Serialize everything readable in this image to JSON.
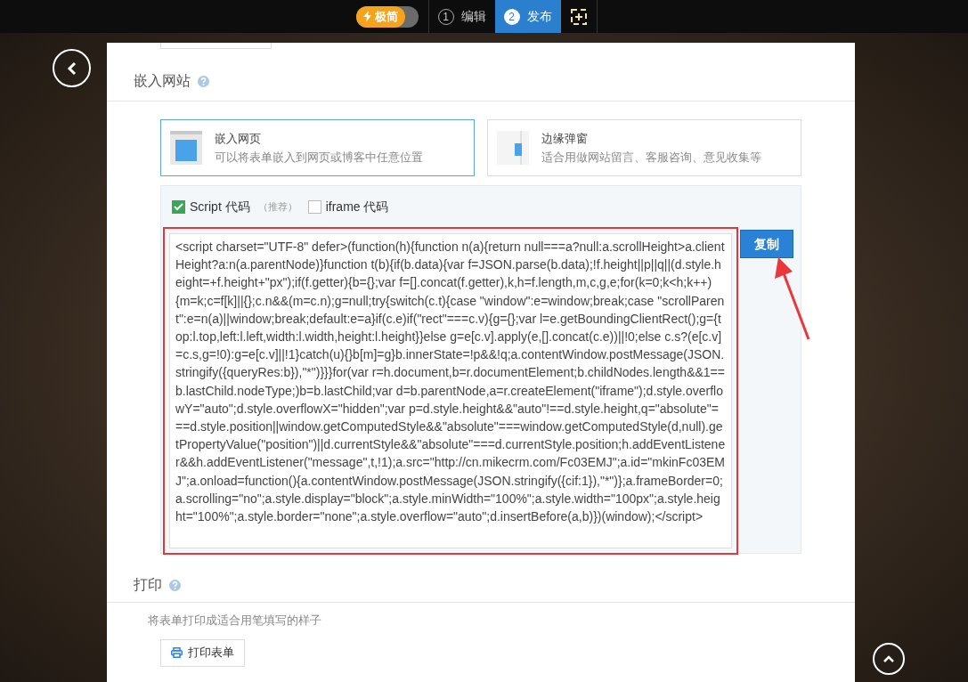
{
  "top_bar": {
    "mode_toggle": {
      "label": "极简",
      "on": true
    },
    "steps": [
      {
        "number": "1",
        "label": "编辑",
        "selected": false
      },
      {
        "number": "2",
        "label": "发布",
        "selected": true
      }
    ]
  },
  "embed_section": {
    "title": "嵌入网站",
    "options": [
      {
        "kind": "page",
        "title": "嵌入网页",
        "description": "可以将表单嵌入到网页或博客中任意位置",
        "selected": true
      },
      {
        "kind": "popup",
        "title": "边缘弹窗",
        "description": "适合用做网站留言、客服咨询、意见收集等",
        "selected": false
      }
    ],
    "code_types": [
      {
        "label": "Script 代码",
        "note": "（推荐）",
        "checked": true
      },
      {
        "label": "iframe 代码",
        "checked": false
      }
    ],
    "code": "<script charset=\"UTF-8\" defer>(function(h){function n(a){return null===a?null:a.scrollHeight>a.clientHeight?a:n(a.parentNode)}function t(b){if(b.data){var f=JSON.parse(b.data);!f.height||p||q||(d.style.height=+f.height+\"px\");if(f.getter){b={};var f=[].concat(f.getter),k,h=f.length,m,c,g,e;for(k=0;k<h;k++){m=k;c=f[k]||{};c.n&&(m=c.n);g=null;try{switch(c.t){case \"window\":e=window;break;case \"scrollParent\":e=n(a)||window;break;default:e=a}if(c.e)if(\"rect\"===c.v){g={};var l=e.getBoundingClientRect();g={top:l.top,left:l.left,width:l.width,height:l.height}}else g=e[c.v].apply(e,[].concat(c.e))||!0;else c.s?(e[c.v]=c.s,g=!0):g=e[c.v]||!1}catch(u){}b[m]=g}b.innerState=!p&&!q;a.contentWindow.postMessage(JSON.stringify({queryRes:b}),\"*\")}}}for(var r=h.document,b=r.documentElement;b.childNodes.length&&1==b.lastChild.nodeType;)b=b.lastChild;var d=b.parentNode,a=r.createElement(\"iframe\");d.style.overflowY=\"auto\";d.style.overflowX=\"hidden\";var p=d.style.height&&\"auto\"!==d.style.height,q=\"absolute\"===d.style.position||window.getComputedStyle&&\"absolute\"===window.getComputedStyle(d,null).getPropertyValue(\"position\")||d.currentStyle&&\"absolute\"===d.currentStyle.position;h.addEventListener&&h.addEventListener(\"message\",t,!1);a.src=\"http://cn.mikecrm.com/Fc03EMJ\";a.id=\"mkinFc03EMJ\";a.onload=function(){a.contentWindow.postMessage(JSON.stringify({cif:1}),\"*\")};a.frameBorder=0;a.scrolling=\"no\";a.style.display=\"block\";a.style.minWidth=\"100%\";a.style.width=\"100px\";a.style.height=\"100%\";a.style.border=\"none\";a.style.overflow=\"auto\";d.insertBefore(a,b)})(window);</script>",
    "copy_button": "复制"
  },
  "print_section": {
    "title": "打印",
    "description": "将表单打印成适合用笔填写的样子",
    "button": "打印表单"
  }
}
